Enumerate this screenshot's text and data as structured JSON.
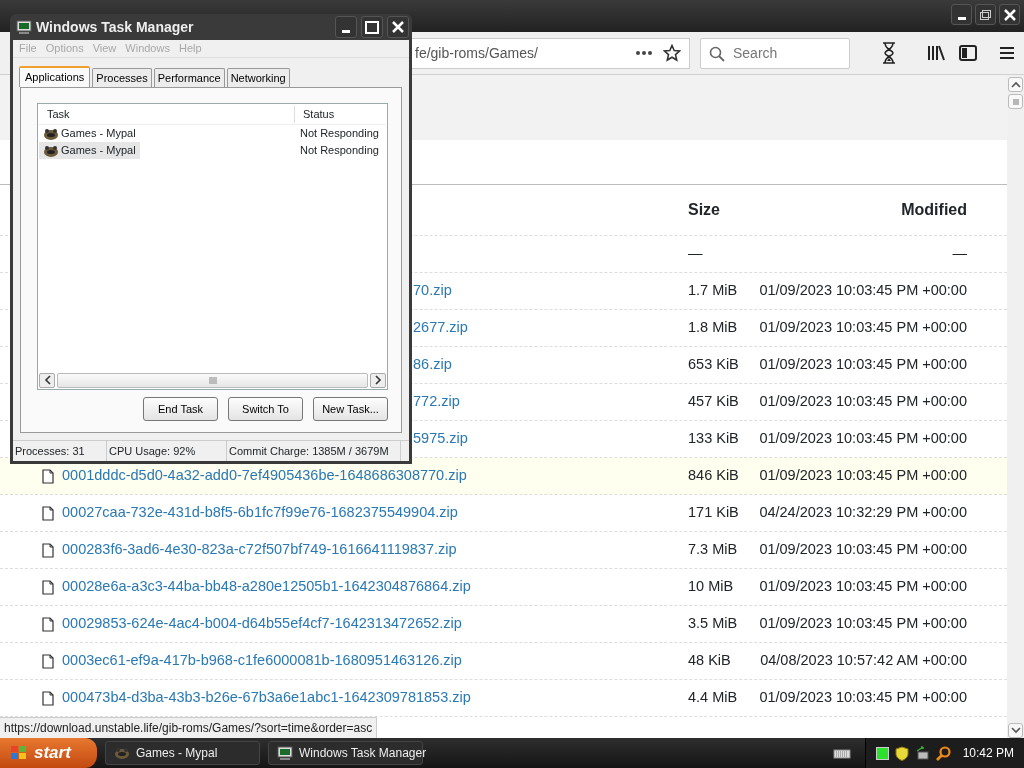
{
  "browser": {
    "address": "fe/gib-roms/Games/",
    "search": {
      "placeholder": "Search"
    },
    "listing": {
      "columns": [
        "Size",
        "Modified"
      ],
      "rows": [
        {
          "kind": "parent",
          "size": "—",
          "modified": "—",
          "hovered": false
        },
        {
          "kind": "cut",
          "name": "70.zip",
          "size": "1.7 MiB",
          "modified": "01/09/2023 10:03:45 PM +00:00",
          "hovered": false
        },
        {
          "kind": "cut",
          "name": "2677.zip",
          "size": "1.8 MiB",
          "modified": "01/09/2023 10:03:45 PM +00:00",
          "hovered": false
        },
        {
          "kind": "cut",
          "name": "86.zip",
          "size": "653 KiB",
          "modified": "01/09/2023 10:03:45 PM +00:00",
          "hovered": false
        },
        {
          "kind": "cut",
          "name": "772.zip",
          "size": "457 KiB",
          "modified": "01/09/2023 10:03:45 PM +00:00",
          "hovered": false
        },
        {
          "kind": "cut",
          "name": "5975.zip",
          "size": "133 KiB",
          "modified": "01/09/2023 10:03:45 PM +00:00",
          "hovered": false
        },
        {
          "kind": "file",
          "name": "0001dddc-d5d0-4a32-add0-7ef4905436be-1648686308770.zip",
          "size": "846 KiB",
          "modified": "01/09/2023 10:03:45 PM +00:00",
          "hovered": true
        },
        {
          "kind": "file",
          "name": "00027caa-732e-431d-b8f5-6b1fc7f99e76-1682375549904.zip",
          "size": "171 KiB",
          "modified": "04/24/2023 10:32:29 PM +00:00",
          "hovered": false
        },
        {
          "kind": "file",
          "name": "000283f6-3ad6-4e30-823a-c72f507bf749-1616641119837.zip",
          "size": "7.3 MiB",
          "modified": "01/09/2023 10:03:45 PM +00:00",
          "hovered": false
        },
        {
          "kind": "file",
          "name": "00028e6a-a3c3-44ba-bb48-a280e12505b1-1642304876864.zip",
          "size": "10 MiB",
          "modified": "01/09/2023 10:03:45 PM +00:00",
          "hovered": false
        },
        {
          "kind": "file",
          "name": "00029853-624e-4ac4-b004-d64b55ef4cf7-1642313472652.zip",
          "size": "3.5 MiB",
          "modified": "01/09/2023 10:03:45 PM +00:00",
          "hovered": false
        },
        {
          "kind": "file",
          "name": "0003ec61-ef9a-417b-b968-c1fe6000081b-1680951463126.zip",
          "size": "48 KiB",
          "modified": "04/08/2023 10:57:42 AM +00:00",
          "hovered": false
        },
        {
          "kind": "file",
          "name": "000473b4-d3ba-43b3-b26e-67b3a6e1abc1-1642309781853.zip",
          "size": "4.4 MiB",
          "modified": "01/09/2023 10:03:45 PM +00:00",
          "hovered": false
        }
      ]
    },
    "status_url": "https://download.unstable.life/gib-roms/Games/?sort=time&order=asc"
  },
  "task_manager": {
    "title": "Windows Task Manager",
    "menu": [
      "File",
      "Options",
      "View",
      "Windows",
      "Help"
    ],
    "tabs": [
      {
        "label": "Applications",
        "selected": true
      },
      {
        "label": "Processes",
        "selected": false
      },
      {
        "label": "Performance",
        "selected": false
      },
      {
        "label": "Networking",
        "selected": false
      }
    ],
    "columns": [
      "Task",
      "Status"
    ],
    "tasks": [
      {
        "name": "Games - Mypal",
        "status": "Not Responding",
        "selected": false
      },
      {
        "name": "Games - Mypal",
        "status": "Not Responding",
        "selected": true
      }
    ],
    "buttons": [
      "End Task",
      "Switch To",
      "New Task..."
    ],
    "status_bar": [
      "Processes: 31",
      "CPU Usage: 92%",
      "Commit Charge: 1385M / 3679M"
    ]
  },
  "taskbar": {
    "start": "start",
    "buttons": [
      {
        "label": "Games - Mypal",
        "kind": "browser"
      },
      {
        "label": "Windows Task Manager",
        "kind": "taskmgr"
      }
    ],
    "clock": "10:42 PM"
  }
}
